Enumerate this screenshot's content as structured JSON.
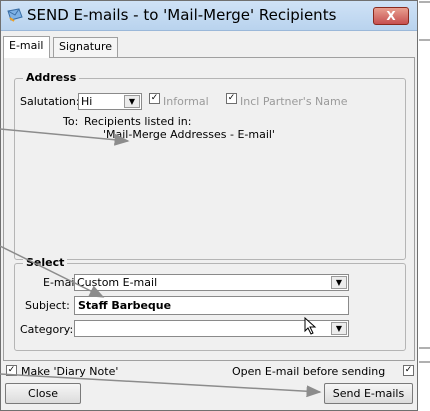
{
  "window": {
    "title": "SEND E-mails - to 'Mail-Merge' Recipients",
    "close_label": "X"
  },
  "tabs": [
    {
      "label": "E-mail",
      "active": true
    },
    {
      "label": "Signature",
      "active": false
    }
  ],
  "address": {
    "legend": "Address",
    "salutation_label": "Salutation:",
    "salutation_value": "Hi",
    "informal_label": "Informal",
    "informal_checked": true,
    "partner_label": "Incl Partner's Name",
    "partner_checked": true,
    "to_label": "To:",
    "to_line1": "Recipients listed in:",
    "to_line2": "'Mail-Merge Addresses - E-mail'"
  },
  "select": {
    "legend": "Select",
    "email_label": "E-mail",
    "email_value": "Custom E-mail",
    "subject_label": "Subject:",
    "subject_value": "Staff Barbeque",
    "category_label": "Category:",
    "category_value": ""
  },
  "footer": {
    "diary_label": "Make 'Diary Note'",
    "diary_checked": true,
    "open_email_label": "Open E-mail before sending",
    "open_email_checked": true,
    "close_button": "Close",
    "send_button": "Send E-mails"
  },
  "colors": {
    "titlebar": "#c4dbf3",
    "close_button": "#c75050",
    "arrow": "#8c8c8c"
  }
}
